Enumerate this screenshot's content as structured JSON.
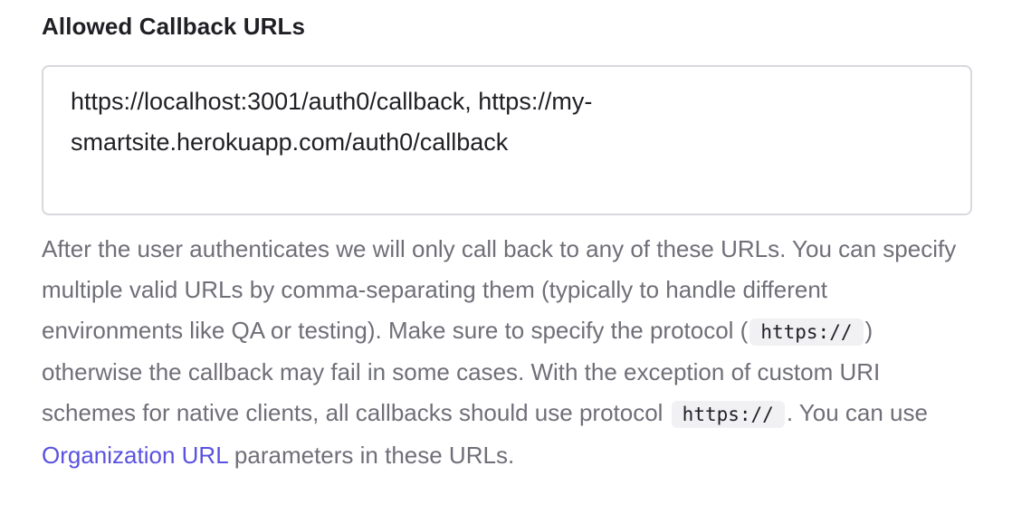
{
  "field": {
    "label": "Allowed Callback URLs",
    "value": "https://localhost:3001/auth0/callback, https://my-smartsite.herokuapp.com/auth0/callback"
  },
  "help": {
    "part1": "After the user authenticates we will only call back to any of these URLs. You can specify multiple valid URLs by comma-separating them (typically to handle different environments like QA or testing). Make sure to specify the protocol (",
    "code1": "https://",
    "part2": ") otherwise the callback may fail in some cases. With the exception of custom URI schemes for native clients, all callbacks should use protocol ",
    "code2": "https://",
    "part3": ". You can use ",
    "link": "Organization URL",
    "part4": " parameters in these URLs."
  },
  "colors": {
    "label": "#1f1f24",
    "help_text": "#6f6f78",
    "border": "#d8d8dd",
    "link": "#5a52e0",
    "code_bg": "#f1f1f3"
  }
}
